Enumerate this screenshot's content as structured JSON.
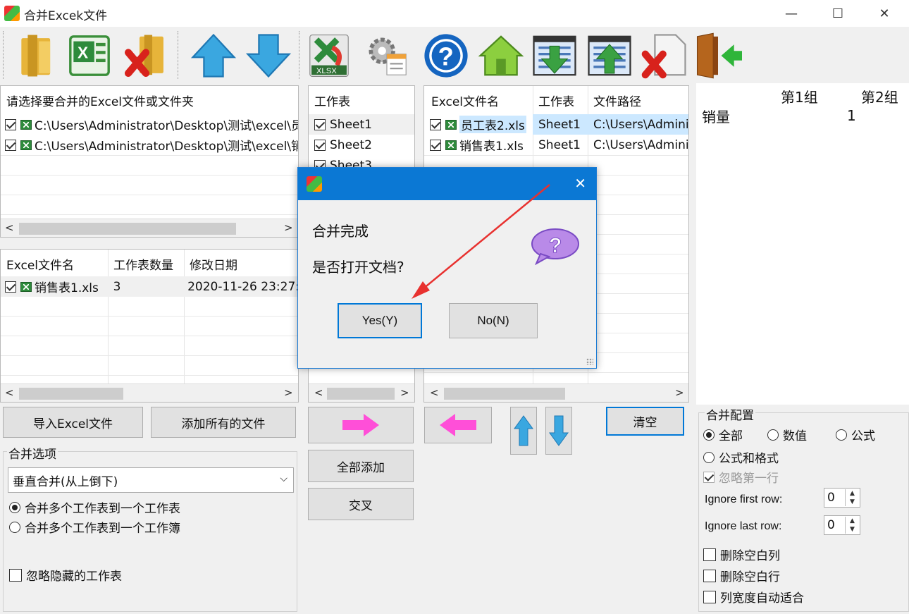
{
  "window": {
    "title": "合并Excek文件",
    "minimize": "—",
    "maximize": "☐",
    "close": "✕"
  },
  "toolbar": {
    "icons": [
      "open-folder-icon",
      "excel-file-icon",
      "delete-folder-icon",
      "move-up-icon",
      "move-down-icon",
      "xlsx-convert-icon",
      "settings-icon",
      "help-icon",
      "home-icon",
      "import-list-icon",
      "export-list-icon",
      "delete-file-icon",
      "exit-door-icon"
    ]
  },
  "file_panel": {
    "header": "请选择要合并的Excel文件或文件夹",
    "items": [
      "C:\\Users\\Administrator\\Desktop\\测试\\excel\\员",
      "C:\\Users\\Administrator\\Desktop\\测试\\excel\\销"
    ]
  },
  "file_table": {
    "columns": [
      "Excel文件名",
      "工作表数量",
      "修改日期"
    ],
    "rows": [
      {
        "name": "销售表1.xls",
        "count": "3",
        "date": "2020-11-26 23:27:"
      }
    ]
  },
  "sheet_panel": {
    "header": "工作表",
    "items": [
      "Sheet1",
      "Sheet2",
      "Sheet3"
    ]
  },
  "selected_table": {
    "columns": [
      "Excel文件名",
      "工作表",
      "文件路径"
    ],
    "rows": [
      {
        "name": "员工表2.xls",
        "sheet": "Sheet1",
        "path": "C:\\Users\\Admini"
      },
      {
        "name": "销售表1.xls",
        "sheet": "Sheet1",
        "path": "C:\\Users\\Admini"
      }
    ]
  },
  "preview": {
    "col1": "第1组",
    "col2": "第2组",
    "row_label": "销量",
    "value": "1"
  },
  "buttons": {
    "import": "导入Excel文件",
    "add_all_files": "添加所有的文件",
    "add_all": "全部添加",
    "cross": "交叉",
    "clear": "清空"
  },
  "merge_options": {
    "label": "合并选项",
    "mode": "垂直合并(从上倒下)",
    "radio1": "合并多个工作表到一个工作表",
    "radio2": "合并多个工作表到一个工作簿",
    "ignore_hidden": "忽略隐藏的工作表"
  },
  "merge_config": {
    "label": "合并配置",
    "opt_all": "全部",
    "opt_value": "数值",
    "opt_formula": "公式",
    "opt_formula_format": "公式和格式",
    "ignore_first_row": "忽略第一行",
    "ignore_first_label": "Ignore first row:",
    "ignore_first_value": "0",
    "ignore_last_label": "Ignore last row:",
    "ignore_last_value": "0",
    "del_blank_col": "删除空白列",
    "del_blank_row": "删除空白行",
    "autofit": "列宽度自动适合"
  },
  "dialog": {
    "message1": "合并完成",
    "message2": "是否打开文档?",
    "yes": "Yes(Y)",
    "no": "No(N)",
    "close": "✕"
  },
  "colors": {
    "accent": "#0078d7",
    "dialog_title": "#0b78d4",
    "arrow": "#e8312f",
    "highlight": "#cce8ff"
  }
}
